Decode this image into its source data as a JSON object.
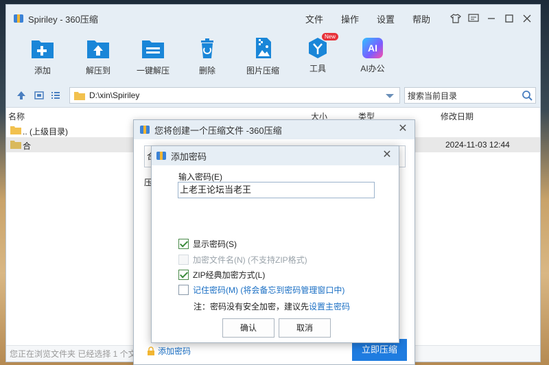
{
  "window": {
    "title": "Spiriley - 360压缩",
    "menu": [
      "文件",
      "操作",
      "设置",
      "帮助"
    ]
  },
  "toolbar": {
    "items": [
      {
        "label": "添加",
        "icon": "add-icon"
      },
      {
        "label": "解压到",
        "icon": "extract-to-icon"
      },
      {
        "label": "一键解压",
        "icon": "one-click-extract-icon"
      },
      {
        "label": "删除",
        "icon": "delete-icon"
      },
      {
        "label": "图片压缩",
        "icon": "image-compress-icon"
      },
      {
        "label": "工具",
        "icon": "tools-icon",
        "badge": "New"
      },
      {
        "label": "AI办公",
        "icon": "ai-office-icon",
        "icon_text": "AI"
      }
    ]
  },
  "address": {
    "path": "D:\\xin\\Spiriley",
    "search_placeholder": "搜索当前目录"
  },
  "columns": {
    "name": "名称",
    "size": "大小",
    "type": "类型",
    "date": "修改日期"
  },
  "files": [
    {
      "name": ".. (上级目录)",
      "date": ""
    },
    {
      "name": "合",
      "date": "2024-11-03 12:44"
    }
  ],
  "statusbar": {
    "text": "您正在浏览文件夹 已经选择 1 个文"
  },
  "create_dialog": {
    "title": "您将创建一个压缩文件 -360压缩",
    "name_value": "合",
    "label2": "压",
    "add_password": "添加密码",
    "compress_button": "立即压缩"
  },
  "password_dialog": {
    "title": "添加密码",
    "label": "输入密码(E)",
    "value": "上老王论坛当老王",
    "options": [
      {
        "text": "显示密码(S)",
        "checked": true,
        "disabled": false,
        "style": "normal"
      },
      {
        "text": "加密文件名(N) (不支持ZIP格式)",
        "checked": false,
        "disabled": true,
        "style": "disabled"
      },
      {
        "text": "ZIP经典加密方式(L)",
        "checked": true,
        "disabled": false,
        "style": "normal"
      },
      {
        "text": "记住密码(M) (将会备忘到密码管理窗口中)",
        "checked": false,
        "disabled": false,
        "style": "blue"
      }
    ],
    "note_prefix": "注：密码没有安全加密，建议先",
    "note_link": "设置主密码",
    "ok": "确认",
    "cancel": "取消"
  },
  "colors": {
    "accent": "#1f7ce0",
    "link": "#1a6fc4",
    "chrome": "#e6eef5"
  }
}
